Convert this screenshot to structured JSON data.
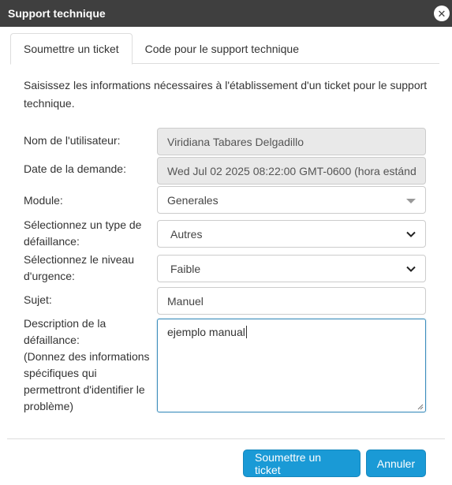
{
  "dialog": {
    "title": "Support technique"
  },
  "tabs": [
    {
      "label": "Soumettre un ticket",
      "active": true
    },
    {
      "label": "Code pour le support technique",
      "active": false
    }
  ],
  "intro": "Saisissez les informations nécessaires à l'établissement d'un ticket pour le support technique.",
  "form": {
    "username": {
      "label": "Nom de l'utilisateur:",
      "value": "Viridiana Tabares Delgadillo"
    },
    "request_date": {
      "label": "Date de la demande:",
      "value": "Wed Jul 02 2025 08:22:00 GMT-0600 (hora estánd"
    },
    "module": {
      "label": "Module:",
      "value": "Generales"
    },
    "failure_type": {
      "label_line1": "Sélectionnez un type de",
      "label_line2": "défaillance:",
      "value": "Autres"
    },
    "urgency": {
      "label_line1": "Sélectionnez le niveau",
      "label_line2": "d'urgence:",
      "value": "Faible"
    },
    "subject": {
      "label": "Sujet:",
      "value": "Manuel"
    },
    "description": {
      "label_lines": [
        "Description de la",
        "défaillance:",
        "(Donnez des informations",
        "spécifiques qui",
        "permettront d'identifier le",
        "problème)"
      ],
      "value": "ejemplo manual"
    }
  },
  "buttons": {
    "submit": "Soumettre un ticket",
    "cancel": "Annuler"
  },
  "colors": {
    "titlebar": "#3f3f3f",
    "primary": "#1a9ad6",
    "readonly_bg": "#e9e9e9",
    "focus_border": "#3c8dbc"
  }
}
